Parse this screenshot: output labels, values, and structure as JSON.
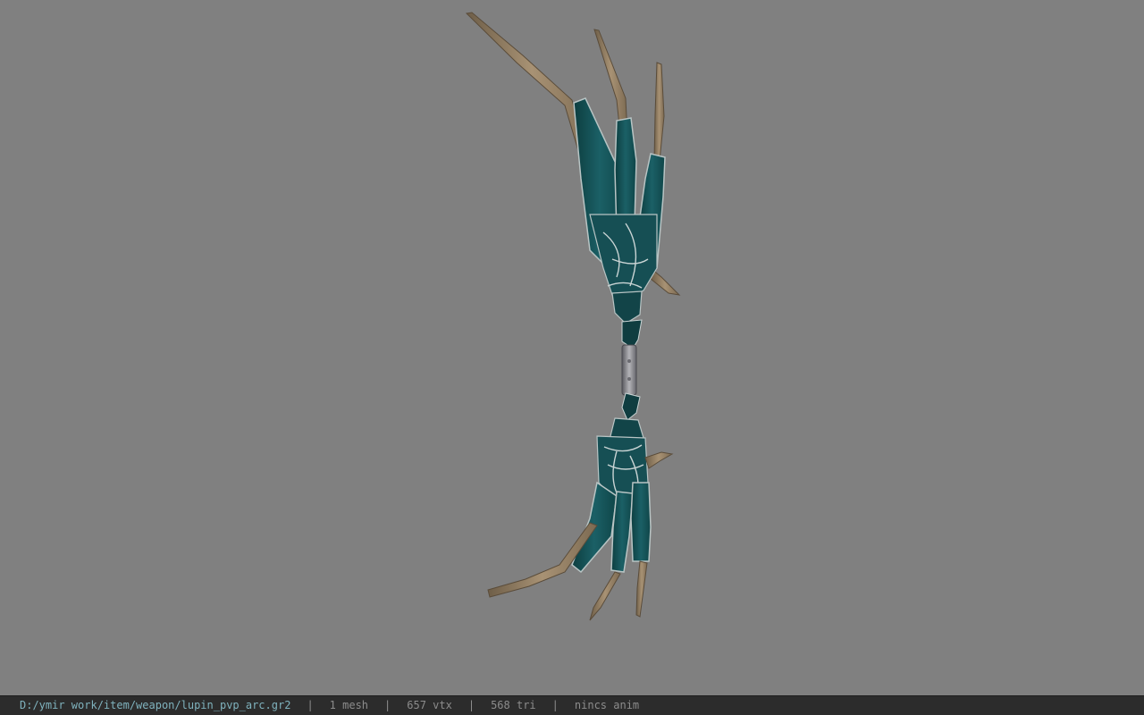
{
  "viewport": {
    "background": "#808080",
    "model": "bow-3d-model"
  },
  "status": {
    "path": "D:/ymir work/item/weapon/lupin_pvp_arc.gr2",
    "separator": "|",
    "meshes": "1 mesh",
    "vertices": "657 vtx",
    "triangles": "568 tri",
    "anim": "nincs anim"
  }
}
